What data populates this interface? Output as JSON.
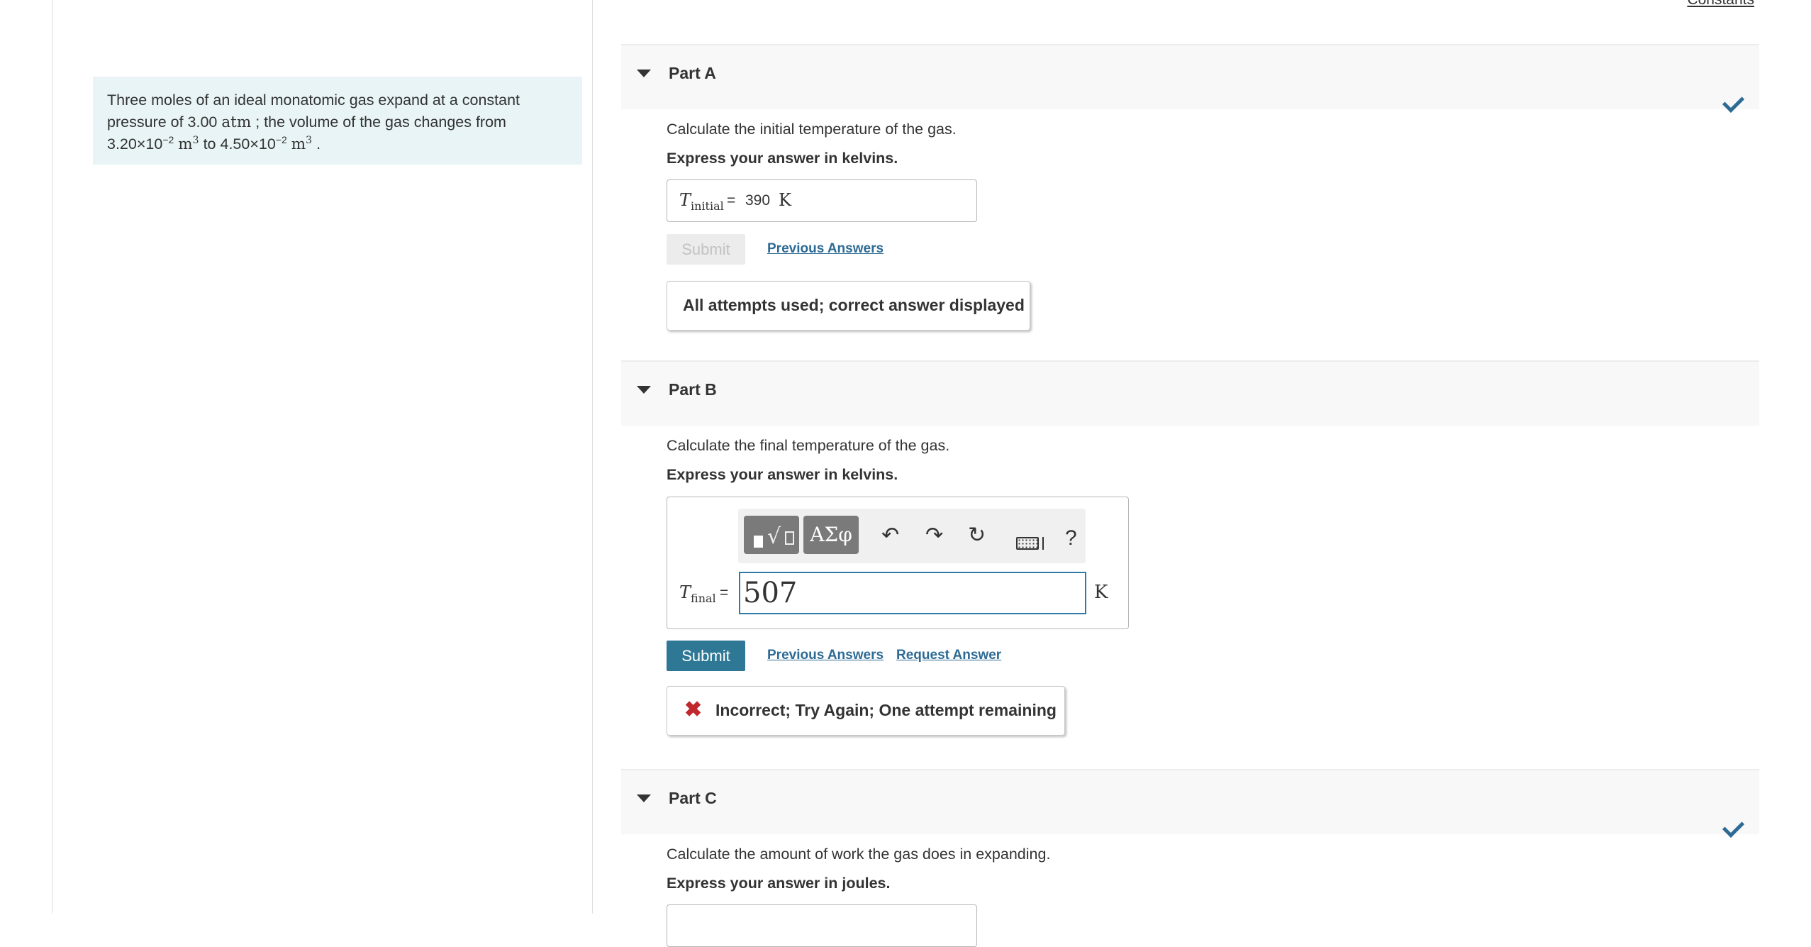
{
  "header": {
    "constants_link": "Constants"
  },
  "problem": {
    "text_1": "Three moles of an ideal monatomic gas expand at a constant pressure of 3.00",
    "unit_pressure": "atm",
    "text_2": "; the volume of the gas changes from",
    "v1_mantissa": "3.20×10",
    "v1_exp": "−2",
    "v2_mantissa": "4.50×10",
    "v2_exp": "−2",
    "unit_volume": "m",
    "unit_volume_exp": "3",
    "to": "to",
    "end": "."
  },
  "parts": {
    "a": {
      "label": "Part A",
      "status": "correct",
      "prompt": "Calculate the initial temperature of the gas.",
      "express": "Express your answer in kelvins.",
      "symbol": "T",
      "symbol_sub": "initial",
      "equals": "=",
      "value": "390",
      "unit": "K",
      "submit": "Submit",
      "previous_answers": "Previous Answers",
      "feedback": "All attempts used; correct answer displayed"
    },
    "b": {
      "label": "Part B",
      "prompt": "Calculate the final temperature of the gas.",
      "express": "Express your answer in kelvins.",
      "toolbar": {
        "greek_label": "ΑΣφ",
        "undo_icon": "undo-icon",
        "redo_icon": "redo-icon",
        "reset_icon": "reset-icon",
        "keyboard_icon": "keyboard-icon",
        "help_label": "?"
      },
      "symbol": "T",
      "symbol_sub": "final",
      "equals": "=",
      "value": "507",
      "unit": "K",
      "submit": "Submit",
      "previous_answers": "Previous Answers",
      "request_answer": "Request Answer",
      "feedback": "Incorrect; Try Again; One attempt remaining"
    },
    "c": {
      "label": "Part C",
      "status": "correct",
      "prompt": "Calculate the amount of work the gas does in expanding.",
      "express": "Express your answer in joules."
    }
  },
  "colors": {
    "accent": "#2f7895",
    "link": "#2d6a94",
    "check": "#2d6a94",
    "error": "#c0282d",
    "problem_bg": "#e8f4f6"
  }
}
